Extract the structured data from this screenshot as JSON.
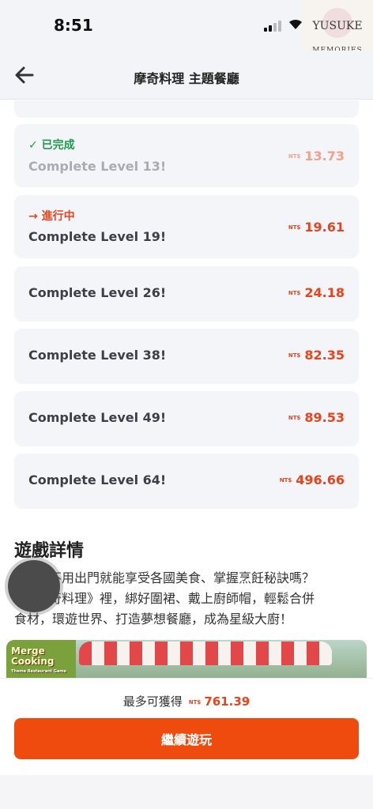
{
  "status_bar": {
    "time": "8:51",
    "signal_icon": "signal-bars-icon",
    "wifi_icon": "wifi-icon"
  },
  "watermark": {
    "name": "YUSUKE",
    "sub": "MEMORIES"
  },
  "header": {
    "title": "摩奇料理 主題餐廳",
    "back_icon": "back-arrow-icon"
  },
  "currency": "NT$",
  "tasks": [
    {
      "status": "✓ 已完成",
      "state": "done",
      "label": "Complete Level 13!",
      "reward": "13.73"
    },
    {
      "status": "→ 進行中",
      "state": "progress",
      "label": "Complete Level 19!",
      "reward": "19.61"
    },
    {
      "status": "",
      "state": "locked",
      "label": "Complete Level 26!",
      "reward": "24.18"
    },
    {
      "status": "",
      "state": "locked",
      "label": "Complete Level 38!",
      "reward": "82.35"
    },
    {
      "status": "",
      "state": "locked",
      "label": "Complete Level 49!",
      "reward": "89.53"
    },
    {
      "status": "",
      "state": "locked",
      "label": "Complete Level 64!",
      "reward": "496.66"
    }
  ],
  "details": {
    "title": "遊戲詳情",
    "text_visible": "不用出門就能享受各國美食、掌握烹飪秘訣嗎？奇料理》裡，綁好圍裙、戴上廚師帽，輕鬆合併食材，環遊世界、打造夢想餐廳，成為星級大廚！",
    "line1": "不用出門就能享受各國美食、掌握烹飪秘訣嗎？",
    "line2": "奇料理》裡，綁好圍裙、戴上廚師帽，輕鬆合併",
    "line3": "食材，環遊世界、打造夢想餐廳，成為星級大廚！"
  },
  "banner": {
    "logo_line1": "Merge",
    "logo_line2": "Cooking",
    "logo_sub": "Theme Restaurant Game"
  },
  "bottom": {
    "max_label": "最多可獲得",
    "max_amount": "761.39",
    "cta_label": "繼續遊玩"
  },
  "colors": {
    "accent": "#f04b0e",
    "done": "#1e9a4b",
    "card_bg": "#f4f5f8"
  }
}
